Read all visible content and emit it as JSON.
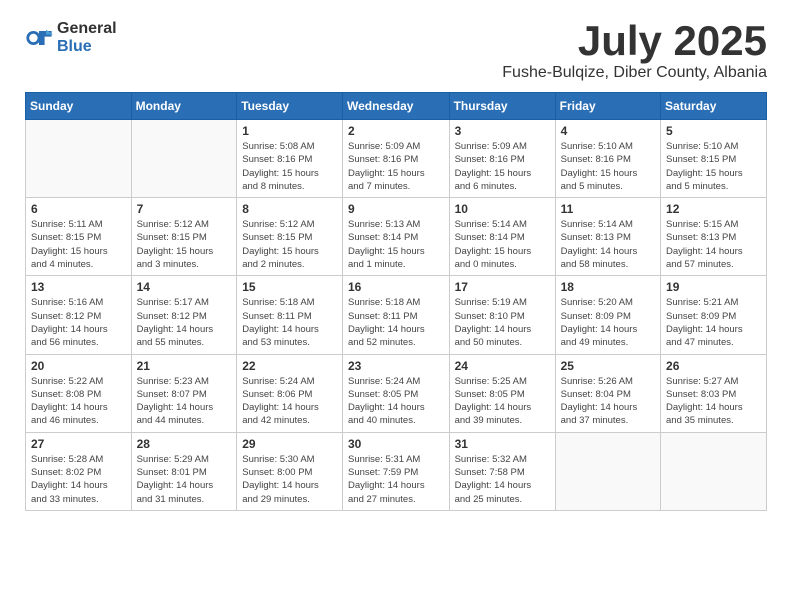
{
  "header": {
    "logo_general": "General",
    "logo_blue": "Blue",
    "month_year": "July 2025",
    "location": "Fushe-Bulqize, Diber County, Albania"
  },
  "weekdays": [
    "Sunday",
    "Monday",
    "Tuesday",
    "Wednesday",
    "Thursday",
    "Friday",
    "Saturday"
  ],
  "weeks": [
    [
      {
        "day": "",
        "info": ""
      },
      {
        "day": "",
        "info": ""
      },
      {
        "day": "1",
        "info": "Sunrise: 5:08 AM\nSunset: 8:16 PM\nDaylight: 15 hours\nand 8 minutes."
      },
      {
        "day": "2",
        "info": "Sunrise: 5:09 AM\nSunset: 8:16 PM\nDaylight: 15 hours\nand 7 minutes."
      },
      {
        "day": "3",
        "info": "Sunrise: 5:09 AM\nSunset: 8:16 PM\nDaylight: 15 hours\nand 6 minutes."
      },
      {
        "day": "4",
        "info": "Sunrise: 5:10 AM\nSunset: 8:16 PM\nDaylight: 15 hours\nand 5 minutes."
      },
      {
        "day": "5",
        "info": "Sunrise: 5:10 AM\nSunset: 8:15 PM\nDaylight: 15 hours\nand 5 minutes."
      }
    ],
    [
      {
        "day": "6",
        "info": "Sunrise: 5:11 AM\nSunset: 8:15 PM\nDaylight: 15 hours\nand 4 minutes."
      },
      {
        "day": "7",
        "info": "Sunrise: 5:12 AM\nSunset: 8:15 PM\nDaylight: 15 hours\nand 3 minutes."
      },
      {
        "day": "8",
        "info": "Sunrise: 5:12 AM\nSunset: 8:15 PM\nDaylight: 15 hours\nand 2 minutes."
      },
      {
        "day": "9",
        "info": "Sunrise: 5:13 AM\nSunset: 8:14 PM\nDaylight: 15 hours\nand 1 minute."
      },
      {
        "day": "10",
        "info": "Sunrise: 5:14 AM\nSunset: 8:14 PM\nDaylight: 15 hours\nand 0 minutes."
      },
      {
        "day": "11",
        "info": "Sunrise: 5:14 AM\nSunset: 8:13 PM\nDaylight: 14 hours\nand 58 minutes."
      },
      {
        "day": "12",
        "info": "Sunrise: 5:15 AM\nSunset: 8:13 PM\nDaylight: 14 hours\nand 57 minutes."
      }
    ],
    [
      {
        "day": "13",
        "info": "Sunrise: 5:16 AM\nSunset: 8:12 PM\nDaylight: 14 hours\nand 56 minutes."
      },
      {
        "day": "14",
        "info": "Sunrise: 5:17 AM\nSunset: 8:12 PM\nDaylight: 14 hours\nand 55 minutes."
      },
      {
        "day": "15",
        "info": "Sunrise: 5:18 AM\nSunset: 8:11 PM\nDaylight: 14 hours\nand 53 minutes."
      },
      {
        "day": "16",
        "info": "Sunrise: 5:18 AM\nSunset: 8:11 PM\nDaylight: 14 hours\nand 52 minutes."
      },
      {
        "day": "17",
        "info": "Sunrise: 5:19 AM\nSunset: 8:10 PM\nDaylight: 14 hours\nand 50 minutes."
      },
      {
        "day": "18",
        "info": "Sunrise: 5:20 AM\nSunset: 8:09 PM\nDaylight: 14 hours\nand 49 minutes."
      },
      {
        "day": "19",
        "info": "Sunrise: 5:21 AM\nSunset: 8:09 PM\nDaylight: 14 hours\nand 47 minutes."
      }
    ],
    [
      {
        "day": "20",
        "info": "Sunrise: 5:22 AM\nSunset: 8:08 PM\nDaylight: 14 hours\nand 46 minutes."
      },
      {
        "day": "21",
        "info": "Sunrise: 5:23 AM\nSunset: 8:07 PM\nDaylight: 14 hours\nand 44 minutes."
      },
      {
        "day": "22",
        "info": "Sunrise: 5:24 AM\nSunset: 8:06 PM\nDaylight: 14 hours\nand 42 minutes."
      },
      {
        "day": "23",
        "info": "Sunrise: 5:24 AM\nSunset: 8:05 PM\nDaylight: 14 hours\nand 40 minutes."
      },
      {
        "day": "24",
        "info": "Sunrise: 5:25 AM\nSunset: 8:05 PM\nDaylight: 14 hours\nand 39 minutes."
      },
      {
        "day": "25",
        "info": "Sunrise: 5:26 AM\nSunset: 8:04 PM\nDaylight: 14 hours\nand 37 minutes."
      },
      {
        "day": "26",
        "info": "Sunrise: 5:27 AM\nSunset: 8:03 PM\nDaylight: 14 hours\nand 35 minutes."
      }
    ],
    [
      {
        "day": "27",
        "info": "Sunrise: 5:28 AM\nSunset: 8:02 PM\nDaylight: 14 hours\nand 33 minutes."
      },
      {
        "day": "28",
        "info": "Sunrise: 5:29 AM\nSunset: 8:01 PM\nDaylight: 14 hours\nand 31 minutes."
      },
      {
        "day": "29",
        "info": "Sunrise: 5:30 AM\nSunset: 8:00 PM\nDaylight: 14 hours\nand 29 minutes."
      },
      {
        "day": "30",
        "info": "Sunrise: 5:31 AM\nSunset: 7:59 PM\nDaylight: 14 hours\nand 27 minutes."
      },
      {
        "day": "31",
        "info": "Sunrise: 5:32 AM\nSunset: 7:58 PM\nDaylight: 14 hours\nand 25 minutes."
      },
      {
        "day": "",
        "info": ""
      },
      {
        "day": "",
        "info": ""
      }
    ]
  ]
}
